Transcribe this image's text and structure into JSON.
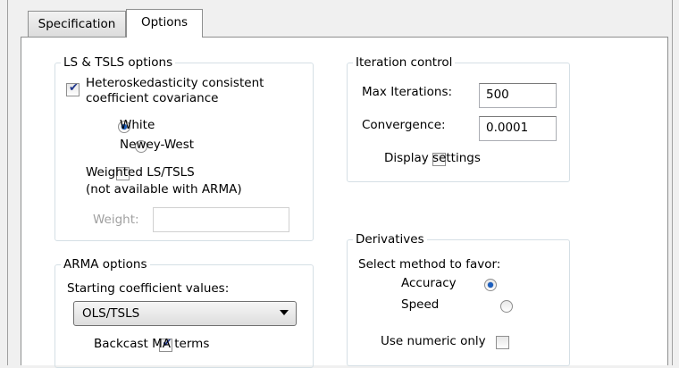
{
  "tabs": [
    {
      "label": "Specification"
    },
    {
      "label": "Options"
    }
  ],
  "ls_tsls": {
    "title": "LS & TSLS options",
    "hetero_line1": "Heteroskedasticity consistent",
    "hetero_line2": "coefficient covariance",
    "hetero_checked": true,
    "white_label": "White",
    "newey_label": "Newey-West",
    "selected": "White",
    "weighted_line1": "Weighted LS/TSLS",
    "weighted_line2": "(not available with ARMA)",
    "weighted_checked": false,
    "weight_label": "Weight:",
    "weight_value": ""
  },
  "iteration": {
    "title": "Iteration control",
    "max_iter_label": "Max Iterations:",
    "max_iter_value": "500",
    "convergence_label": "Convergence:",
    "convergence_value": "0.0001",
    "display_label": "Display settings",
    "display_checked": false
  },
  "arma": {
    "title": "ARMA options",
    "start_label": "Starting coefficient values:",
    "start_value": "OLS/TSLS",
    "backcast_label": "Backcast MA terms",
    "backcast_checked": true
  },
  "derivatives": {
    "title": "Derivatives",
    "select_label": "Select method to favor:",
    "accuracy_label": "Accuracy",
    "speed_label": "Speed",
    "selected": "Accuracy",
    "numeric_label": "Use numeric only",
    "numeric_checked": false
  }
}
